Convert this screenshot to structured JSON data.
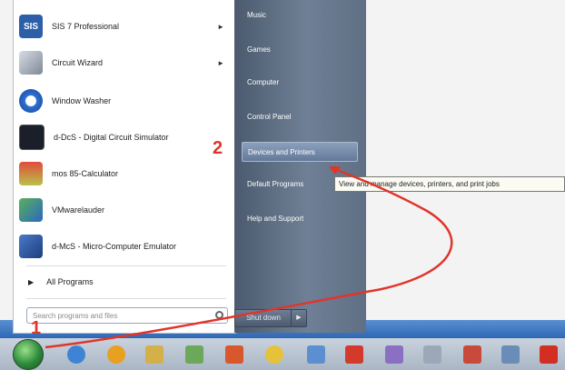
{
  "start_menu": {
    "programs": [
      {
        "label": "SIS 7 Professional",
        "icon": "sis-icon",
        "icon_text": "SIS",
        "has_submenu": true
      },
      {
        "label": "Circuit Wizard",
        "icon": "circuit-wizard-icon",
        "icon_text": "",
        "has_submenu": true
      },
      {
        "label": "Window Washer",
        "icon": "window-washer-icon",
        "icon_text": "",
        "has_submenu": false
      },
      {
        "label": "d-DcS - Digital Circuit Simulator",
        "icon": "digital-circuit-simulator-icon",
        "icon_text": "",
        "has_submenu": false
      },
      {
        "label": "mos 85-Calculator",
        "icon": "calculator-icon",
        "icon_text": "",
        "has_submenu": false
      },
      {
        "label": "VMwarelauder",
        "icon": "vm-icon",
        "icon_text": "",
        "has_submenu": false
      },
      {
        "label": "d-McS - Micro-Computer Emulator",
        "icon": "micro-computer-emulator-icon",
        "icon_text": "",
        "has_submenu": false
      }
    ],
    "all_programs_label": "All Programs",
    "search_placeholder": "Search programs and files",
    "right_items": [
      {
        "label": "Music",
        "highlighted": false
      },
      {
        "label": "Games",
        "highlighted": false
      },
      {
        "label": "Computer",
        "highlighted": false
      },
      {
        "label": "Control Panel",
        "highlighted": false
      },
      {
        "label": "Devices and Printers",
        "highlighted": true
      },
      {
        "label": "Default Programs",
        "highlighted": false
      },
      {
        "label": "Help and Support",
        "highlighted": false
      }
    ],
    "shutdown_label": "Shut down",
    "tooltip": "View and manage devices, printers, and print jobs"
  },
  "annotations": {
    "step1": "1",
    "step2": "2"
  },
  "colors": {
    "accent_red": "#e0352b",
    "right_pane": "#5f6f84",
    "taskbar": "#b9c4d1"
  }
}
